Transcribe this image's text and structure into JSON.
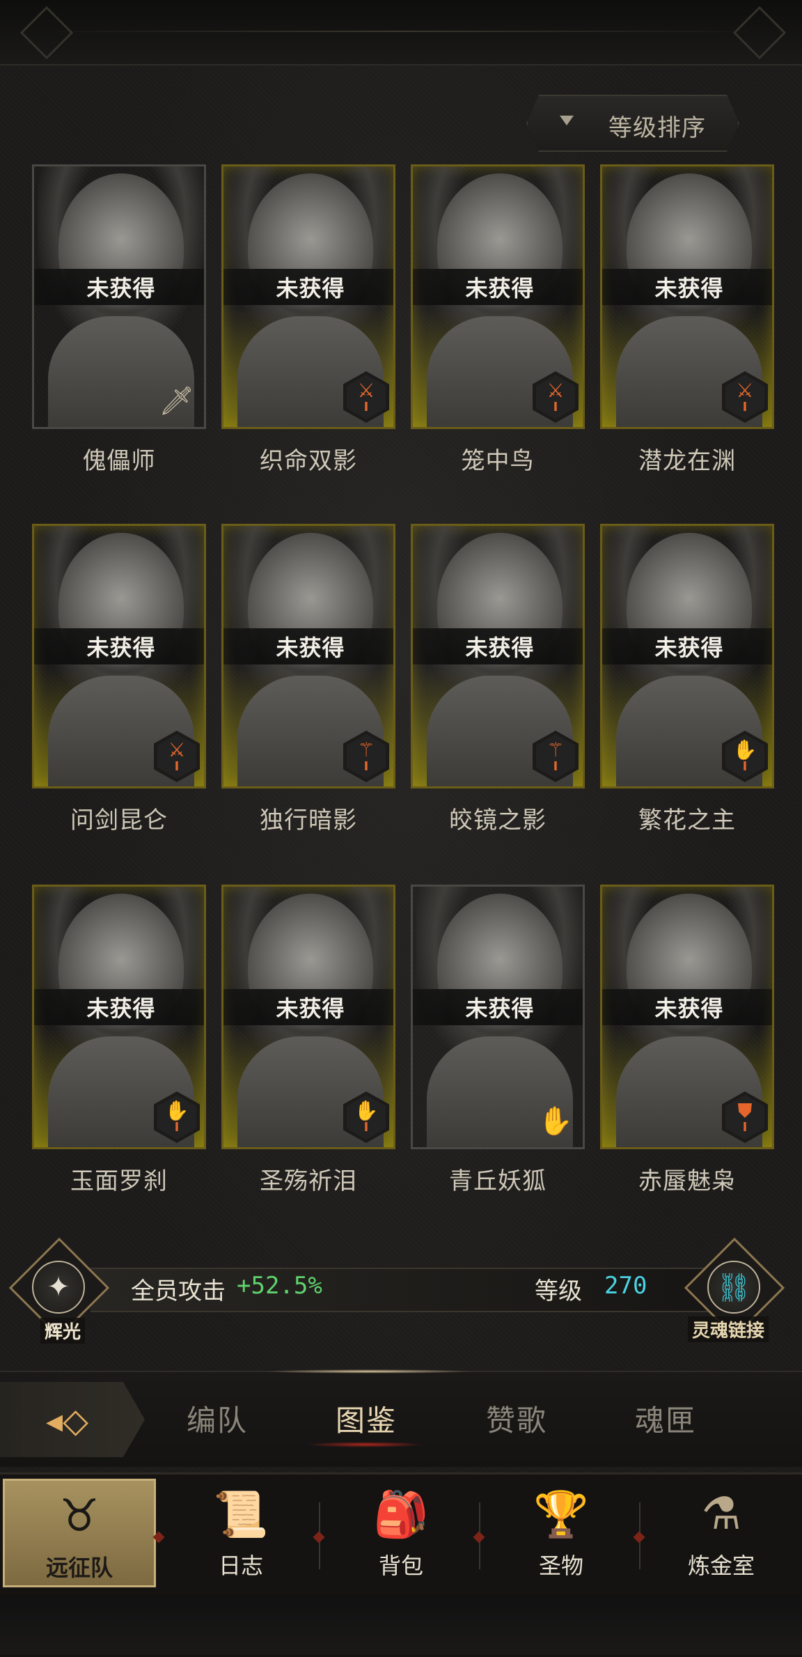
{
  "sort": {
    "label": "等级排序"
  },
  "heroes": [
    {
      "name": "傀儡师",
      "status": "未获得",
      "class_icon": "sword-icon",
      "badge": "plain",
      "rank": ""
    },
    {
      "name": "织命双影",
      "status": "未获得",
      "class_icon": "sword-icon",
      "badge": "orange",
      "rank": "I"
    },
    {
      "name": "笼中鸟",
      "status": "未获得",
      "class_icon": "sword-icon",
      "badge": "orange",
      "rank": "I"
    },
    {
      "name": "潜龙在渊",
      "status": "未获得",
      "class_icon": "sword-icon",
      "badge": "orange",
      "rank": "I"
    },
    {
      "name": "问剑昆仑",
      "status": "未获得",
      "class_icon": "sword-icon",
      "badge": "orange",
      "rank": "I"
    },
    {
      "name": "独行暗影",
      "status": "未获得",
      "class_icon": "staff-icon",
      "badge": "orange",
      "rank": "I"
    },
    {
      "name": "皎镜之影",
      "status": "未获得",
      "class_icon": "staff-icon",
      "badge": "orange",
      "rank": "I"
    },
    {
      "name": "繁花之主",
      "status": "未获得",
      "class_icon": "palm-icon",
      "badge": "orange",
      "rank": "I"
    },
    {
      "name": "玉面罗刹",
      "status": "未获得",
      "class_icon": "palm-icon",
      "badge": "orange",
      "rank": "I"
    },
    {
      "name": "圣殇祈泪",
      "status": "未获得",
      "class_icon": "palm-icon",
      "badge": "orange",
      "rank": "I"
    },
    {
      "name": "青丘妖狐",
      "status": "未获得",
      "class_icon": "palm-icon",
      "badge": "plain",
      "rank": ""
    },
    {
      "name": "赤蜃魅枭",
      "status": "未获得",
      "class_icon": "shield-icon",
      "badge": "orange",
      "rank": "I"
    }
  ],
  "stats": {
    "left_emblem_label": "辉光",
    "left_label": "全员攻击",
    "left_value": "+52.5%",
    "right_label": "等级",
    "right_value": "270",
    "right_emblem_label": "灵魂链接"
  },
  "tabs": [
    {
      "label": "编队",
      "active": false
    },
    {
      "label": "图鉴",
      "active": true
    },
    {
      "label": "赞歌",
      "active": false
    },
    {
      "label": "魂匣",
      "active": false
    }
  ],
  "nav": [
    {
      "label": "远征队",
      "icon": "horned-helmet-icon",
      "active": true
    },
    {
      "label": "日志",
      "icon": "scroll-icon",
      "active": false
    },
    {
      "label": "背包",
      "icon": "bag-icon",
      "active": false
    },
    {
      "label": "圣物",
      "icon": "chalice-icon",
      "active": false
    },
    {
      "label": "炼金室",
      "icon": "alchemy-icon",
      "active": false
    }
  ],
  "colors": {
    "gold_frame": "#6b5d17",
    "badge_orange": "#e5662b",
    "stat_green": "#5fd36d",
    "stat_cyan": "#4ad3e4",
    "active_tab": "#e9d7b2"
  }
}
